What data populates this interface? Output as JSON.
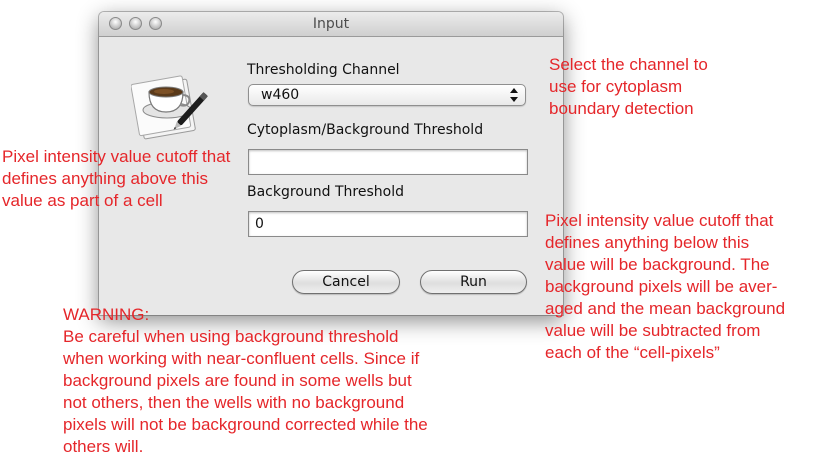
{
  "window": {
    "title": "Input",
    "thresholding_label": "Thresholding Channel",
    "channel_selected": "w460",
    "cyto_label": "Cytoplasm/Background Threshold",
    "cyto_value": "",
    "bg_label": "Background Threshold",
    "bg_value": "0",
    "cancel_label": "Cancel",
    "run_label": "Run"
  },
  "annotations": {
    "channel_note": "Select the channel to\nuse for cytoplasm\nboundary detection",
    "cell_cutoff_note": "Pixel intensity value cutoff that\ndefines anything above this\nvalue as part of a cell",
    "background_note": "Pixel intensity value cutoff that\ndefines anything below this\nvalue will be background.  The\nbackground pixels will be aver-\naged and the mean background\nvalue will be subtracted from\neach of the “cell-pixels”",
    "warning_title": "WARNING:",
    "warning_body": "Be careful when using background threshold\nwhen working with near-confluent cells. Since if\nbackground pixels are found in some wells but\nnot others, then the wells with no background\npixels will not be background corrected while the\nothers will."
  },
  "colors": {
    "annotation": "#e5262a",
    "window_bg": "#e8e8e8"
  },
  "icons": {
    "app": "coffee-cup-with-pen-icon",
    "popup": "up-down-arrows-icon"
  }
}
